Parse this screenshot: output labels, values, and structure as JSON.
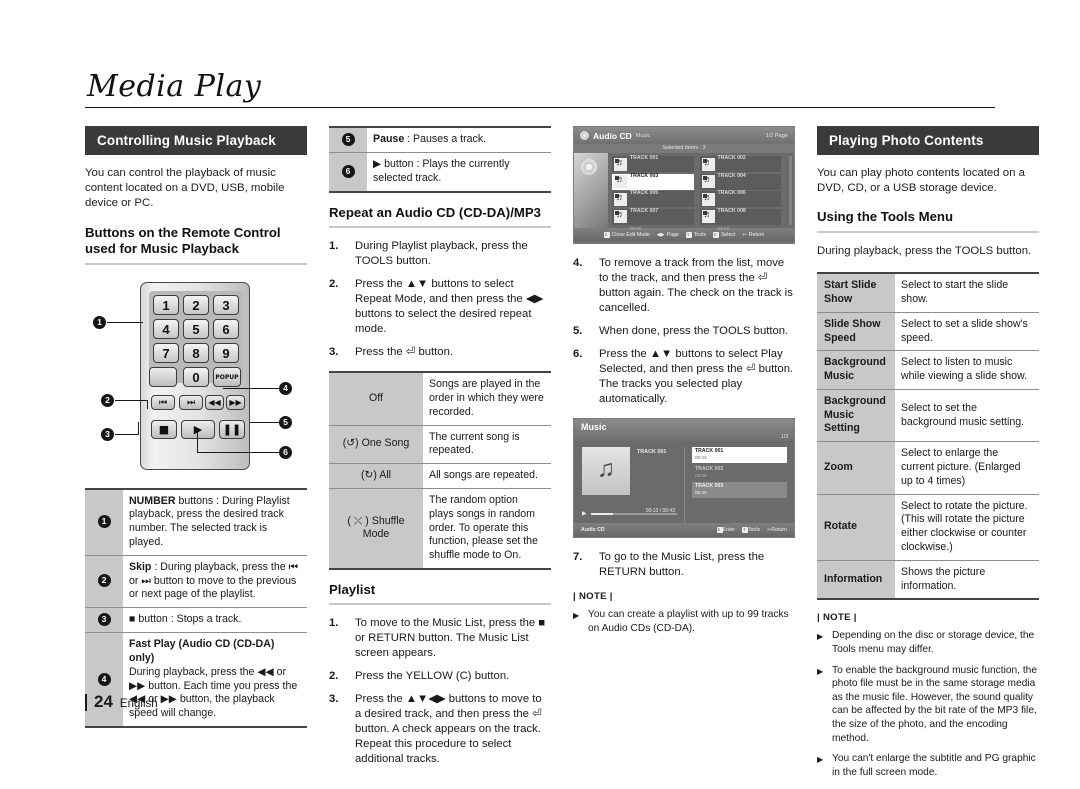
{
  "document": {
    "chapter_title": "Media Play",
    "footer": {
      "page_number": "24",
      "language": "English"
    }
  },
  "column_left": {
    "banner": "Controlling Music Playback",
    "intro": "You can control the playback of music content located on a DVD, USB, mobile device or PC.",
    "subhead": "Buttons on the Remote Control used for Music Playback",
    "remote": {
      "keys": [
        "1",
        "2",
        "3",
        "4",
        "5",
        "6",
        "7",
        "8",
        "9",
        "0"
      ],
      "popup_label": "POPUP",
      "callouts": [
        "1",
        "2",
        "3",
        "4",
        "5",
        "6"
      ]
    },
    "button_table": [
      {
        "num": "1",
        "title": "NUMBER",
        "text": " buttons : During Playlist playback, press the desired track number. The selected track is played."
      },
      {
        "num": "2",
        "title": "Skip",
        "text": " : During playback, press the ⏮ or ⏭ button to move to the previous or next page of the playlist."
      },
      {
        "num": "3",
        "title": "",
        "text": "■ button : Stops a track."
      },
      {
        "num": "4",
        "title": "Fast Play (Audio CD (CD-DA) only)",
        "text": "During playback, press the ◀◀ or ▶▶ button. Each time you press the ◀◀ or ▶▶ button, the playback speed will change."
      }
    ]
  },
  "column_mid": {
    "button_table_cont": [
      {
        "num": "5",
        "title": "Pause",
        "text": " : Pauses a track."
      },
      {
        "num": "6",
        "title": "",
        "text": "▶ button : Plays the currently selected track."
      }
    ],
    "repeat_head": "Repeat an Audio CD (CD-DA)/MP3",
    "repeat_steps": [
      {
        "num": "1.",
        "text": "During Playlist playback, press the TOOLS button."
      },
      {
        "num": "2.",
        "text": "Press the ▲▼ buttons to select Repeat Mode, and then press the ◀▶ buttons to select the desired repeat mode."
      },
      {
        "num": "3.",
        "text": "Press the ⏎ button."
      }
    ],
    "repeat_table": [
      {
        "mode": "Off",
        "icon": "",
        "desc": "Songs are played in the order in which they were recorded."
      },
      {
        "mode": "One Song",
        "icon": "(↺)",
        "desc": "The current song is repeated."
      },
      {
        "mode": "All",
        "icon": "(↻)",
        "desc": "All songs are repeated."
      },
      {
        "mode": "Shuffle Mode",
        "icon": "( ⤬ )",
        "desc": "The random option plays songs in random order. To operate this function, please set the shuffle mode to On."
      }
    ],
    "playlist_head": "Playlist",
    "playlist_steps": [
      {
        "num": "1.",
        "text": "To move to the Music List, press the ■ or RETURN button. The Music List screen appears."
      },
      {
        "num": "2.",
        "text": "Press the YELLOW (C) button."
      },
      {
        "num": "3.",
        "text": "Press the ▲▼◀▶ buttons to move to a desired track, and then press the ⏎ button. A check appears on the track. Repeat this procedure to select additional tracks."
      }
    ]
  },
  "column_right1": {
    "audio_cd_screen": {
      "title": "Audio CD",
      "subtitle": "Music",
      "page_indicator": "1/2 Page",
      "selected_items": "Selected Items : 3",
      "tracks": [
        {
          "name": "TRACK 001",
          "time": "00:43",
          "selected": false
        },
        {
          "name": "TRACK 002",
          "time": "03:56",
          "selected": false
        },
        {
          "name": "TRACK 003",
          "time": "06:45",
          "selected": true
        },
        {
          "name": "TRACK 004",
          "time": "04:02",
          "selected": false
        },
        {
          "name": "TRACK 005",
          "time": "00:43",
          "selected": false
        },
        {
          "name": "TRACK 006",
          "time": "03:40",
          "selected": false
        },
        {
          "name": "TRACK 007",
          "time": "04:06",
          "selected": false
        },
        {
          "name": "TRACK 008",
          "time": "03:42",
          "selected": false
        }
      ],
      "footer_keys": [
        {
          "key": "C",
          "label": "Close Edit Mode"
        },
        {
          "key": "◀▶",
          "label": "Page"
        },
        {
          "key": "T",
          "label": "Tools"
        },
        {
          "key": "E",
          "label": "Select"
        },
        {
          "key": "↩",
          "label": "Return"
        }
      ]
    },
    "steps": [
      {
        "num": "4.",
        "text": "To remove a track from the list, move to the track, and then press the ⏎ button again. The check on the track is cancelled."
      },
      {
        "num": "5.",
        "text": "When done, press the TOOLS button."
      },
      {
        "num": "6.",
        "text": "Press the ▲▼ buttons to select Play Selected, and then press the ⏎ button. The tracks you selected play automatically."
      }
    ],
    "music_screen": {
      "title": "Music",
      "page_indicator": "1/3",
      "now_playing": "TRACK 001",
      "elapsed_total": "00:13 / 00:43",
      "rows": [
        {
          "name": "TRACK 001",
          "time": "00:43",
          "state": "on"
        },
        {
          "name": "TRACK 002",
          "time": "03:56",
          "state": ""
        },
        {
          "name": "TRACK 003",
          "time": "06:45",
          "state": "hl"
        }
      ],
      "footer_left": "Audio CD",
      "footer_keys": [
        {
          "key": "E",
          "label": "Enter"
        },
        {
          "key": "T",
          "label": "Tools"
        },
        {
          "key": "↩",
          "label": "Return"
        }
      ]
    },
    "step7": {
      "num": "7.",
      "text": "To go to the Music List, press the RETURN button."
    },
    "note_head": "| NOTE |",
    "notes": [
      "You can create a playlist with up to 99 tracks on Audio CDs (CD-DA)."
    ]
  },
  "column_right2": {
    "banner": "Playing Photo Contents",
    "intro": "You can play photo contents located on a DVD, CD, or a USB storage device.",
    "subhead": "Using the Tools Menu",
    "lead_text": "During playback, press the TOOLS button.",
    "tools_table": [
      {
        "label": "Start Slide Show",
        "desc": "Select to start the slide show."
      },
      {
        "label": "Slide Show Speed",
        "desc": "Select to set a slide show's speed."
      },
      {
        "label": "Background Music",
        "desc": "Select to listen to music while viewing a slide show."
      },
      {
        "label": "Background Music Setting",
        "desc": "Select to set the background music setting."
      },
      {
        "label": "Zoom",
        "desc": "Select to enlarge the current picture. (Enlarged up to 4 times)"
      },
      {
        "label": "Rotate",
        "desc": "Select to rotate the picture. (This will rotate the picture either clockwise or counter clockwise.)"
      },
      {
        "label": "Information",
        "desc": "Shows the picture information."
      }
    ],
    "note_head": "| NOTE |",
    "notes": [
      "Depending on the disc or storage device, the Tools menu may differ.",
      "To enable the background music function, the photo file must be in the same storage media as the music file. However, the sound quality can be affected by the bit rate of the MP3 file, the size of the photo, and the encoding method.",
      "You can't enlarge the subtitle and PG graphic in the full screen mode."
    ]
  }
}
